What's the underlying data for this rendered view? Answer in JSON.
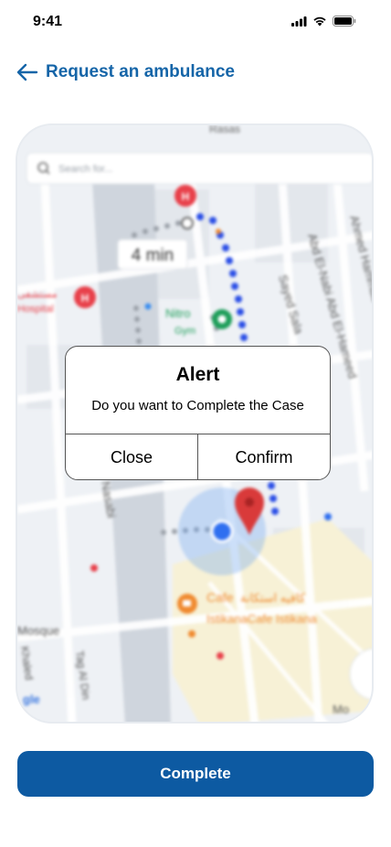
{
  "status_bar": {
    "time": "9:41",
    "icons": [
      "signal-icon",
      "wifi-icon",
      "battery-icon"
    ]
  },
  "header": {
    "back_icon": "arrow-left-icon",
    "title": "Request an ambulance"
  },
  "map": {
    "search_placeholder": "Search for...",
    "eta_label": "4 min",
    "labels": {
      "hospital": "Hospital",
      "hospital_ar": "مستشفى",
      "nitro": "Nitro",
      "gym": "Gym",
      "cafe": "Cafe",
      "cafe_ar": "كافيه استكانة",
      "cafe_istikana": "IstikanaCafe Istikana",
      "mosque": "Mosque",
      "khaled": "Khaled",
      "tag_al_din": "Tag Al Din",
      "nasabi": "Nasabi",
      "sayed_sala": "Sayed Sala",
      "abd_el_nabi": "Abd El-Nabi Abd El-Hameed",
      "ahmed_hammad": "Ahmed Hammad",
      "rasas": "Rasas",
      "mo": "Mo",
      "google": "gle"
    },
    "colors": {
      "route": "#2a4ee6",
      "walk_dots": "#9aa0a8",
      "hospital_pin": "#e8404a",
      "gym_pin": "#1e9e5a",
      "cafe_pin": "#f08a30",
      "destination_pin": "#d93a3a",
      "user_location": "#2f6ff0"
    }
  },
  "alert": {
    "title": "Alert",
    "message": "Do you want to Complete the Case",
    "close_label": "Close",
    "confirm_label": "Confirm"
  },
  "complete_button": {
    "label": "Complete",
    "color": "#0d5aa2"
  }
}
